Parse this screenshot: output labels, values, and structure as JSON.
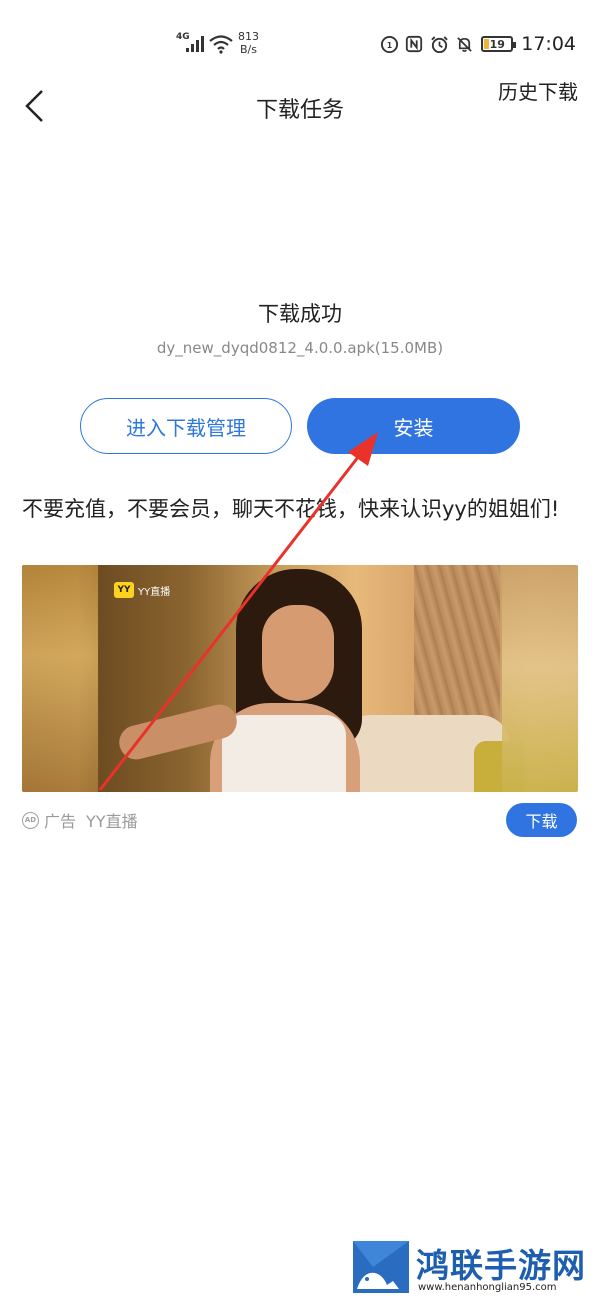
{
  "status_bar": {
    "network": "4G",
    "speed_value": "813",
    "speed_unit": "B/s",
    "battery_level": "19",
    "time": "17:04"
  },
  "header": {
    "title": "下载任务",
    "history_button": "历史下载"
  },
  "download": {
    "status": "下载成功",
    "file_info": "dy_new_dyqd0812_4.0.0.apk(15.0MB)"
  },
  "actions": {
    "manage_label": "进入下载管理",
    "install_label": "安装"
  },
  "ad": {
    "text": "不要充值，不要会员，聊天不花钱，快来认识yy的姐姐们!",
    "image_logo_badge": "YY",
    "image_logo_name": "YY直播",
    "label": "广告",
    "advertiser": "YY直播",
    "download_label": "下载",
    "ad_icon_text": "AD"
  },
  "watermark": {
    "title": "鸿联手游网",
    "url": "www.henanhonglian95.com"
  },
  "colors": {
    "accent": "#2f74e0",
    "annotation_arrow": "#e8322a",
    "watermark_blue": "#1d5fae"
  }
}
